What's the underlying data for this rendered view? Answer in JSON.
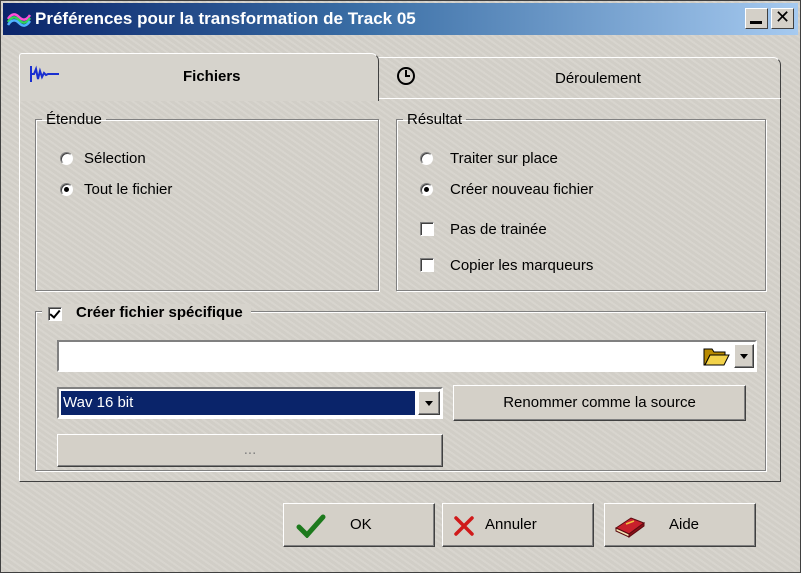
{
  "window": {
    "title": "Préférences pour la transformation de Track 05",
    "minimize_glyph": "▁",
    "close_glyph": "✕"
  },
  "tabs": [
    {
      "label": "Fichiers",
      "icon": "waveform-icon",
      "active": true
    },
    {
      "label": "Déroulement",
      "icon": "clock-icon",
      "active": false
    }
  ],
  "scope": {
    "legend": "Étendue",
    "options": [
      {
        "label": "Sélection",
        "selected": false
      },
      {
        "label": "Tout le fichier",
        "selected": true
      }
    ]
  },
  "result": {
    "legend": "Résultat",
    "options": [
      {
        "label": "Traiter sur place",
        "selected": false
      },
      {
        "label": "Créer nouveau fichier",
        "selected": true
      }
    ],
    "checks": [
      {
        "label": "Pas de trainée",
        "checked": false
      },
      {
        "label": "Copier les marqueurs",
        "checked": false
      }
    ]
  },
  "specific_file": {
    "legend": "Créer fichier spécifique",
    "checked": true,
    "path_value": "",
    "format_selected": "Wav 16 bit",
    "rename_label": "Renommer comme la source",
    "ellipsis_label": "..."
  },
  "footer": {
    "ok_label": "OK",
    "cancel_label": "Annuler",
    "help_label": "Aide"
  },
  "colors": {
    "title_gradient_start": "#0a246a",
    "title_gradient_end": "#a6caf0",
    "selection": "#0a246a",
    "dialog_face": "#d4d0c8"
  }
}
